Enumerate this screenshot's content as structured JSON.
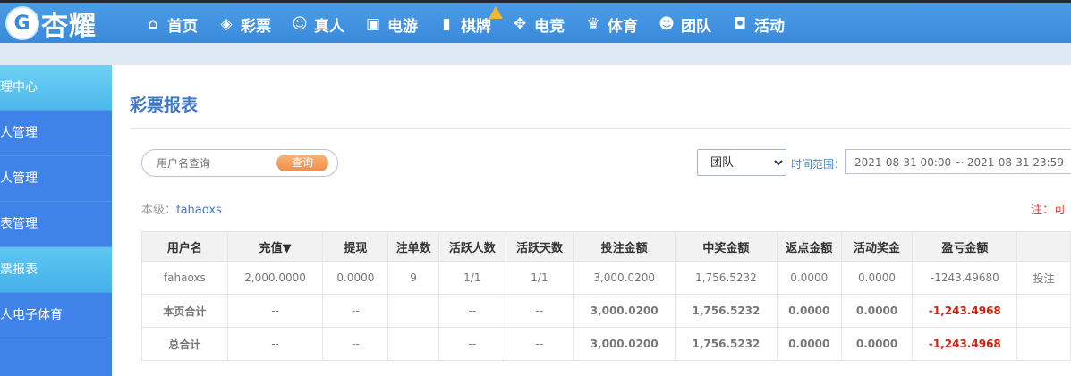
{
  "brand": {
    "name": "杏耀",
    "mark": "G"
  },
  "nav": [
    {
      "label": "首页",
      "icon": "home-icon",
      "glyph": "⌂"
    },
    {
      "label": "彩票",
      "icon": "lottery-icon",
      "glyph": "◈"
    },
    {
      "label": "真人",
      "icon": "user-icon",
      "glyph": "☺"
    },
    {
      "label": "电游",
      "icon": "slot-icon",
      "glyph": "▣"
    },
    {
      "label": "棋牌",
      "icon": "cards-icon",
      "glyph": "▮"
    },
    {
      "label": "电竞",
      "icon": "gamepad-icon",
      "glyph": "✥"
    },
    {
      "label": "体育",
      "icon": "trophy-icon",
      "glyph": "♛"
    },
    {
      "label": "团队",
      "icon": "team-icon",
      "glyph": "☻"
    },
    {
      "label": "活动",
      "icon": "gift-icon",
      "glyph": "◘"
    }
  ],
  "sidebar": {
    "items": [
      {
        "label": "理中心",
        "state": "header"
      },
      {
        "label": "人管理",
        "state": "normal"
      },
      {
        "label": "人管理",
        "state": "normal"
      },
      {
        "label": "表管理",
        "state": "normal"
      },
      {
        "label": "票报表",
        "state": "active"
      },
      {
        "label": "人电子体育",
        "state": "normal"
      }
    ]
  },
  "page": {
    "title": "彩票报表",
    "search": {
      "placeholder": "用户名查询",
      "button": "查询"
    },
    "scope": {
      "selected": "团队"
    },
    "time_label": "时间范围：",
    "time_range": "2021-08-31 00:00 ~ 2021-08-31 23:59",
    "level_label": "本级：",
    "level_user": "fahaoxs",
    "note": "注：可"
  },
  "table": {
    "headers": [
      "用户名",
      "充值▼",
      "提现",
      "注单数",
      "活跃人数",
      "活跃天数",
      "投注金额",
      "中奖金额",
      "返点金额",
      "活动奖金",
      "盈亏金额",
      ""
    ],
    "rows": [
      {
        "cells": [
          "fahaoxs",
          "2,000.0000",
          "0.0000",
          "9",
          "1/1",
          "1/1",
          "3,000.0200",
          "1,756.5232",
          "0.0000",
          "0.0000",
          "-1243.49680",
          "投注"
        ]
      },
      {
        "cells": [
          "本页合计",
          "--",
          "--",
          "",
          "--",
          "--",
          "3,000.0200",
          "1,756.5232",
          "0.0000",
          "0.0000",
          "-1,243.4968",
          ""
        ]
      },
      {
        "cells": [
          "总合计",
          "--",
          "--",
          "",
          "--",
          "--",
          "3,000.0200",
          "1,756.5232",
          "0.0000",
          "0.0000",
          "-1,243.4968",
          ""
        ]
      }
    ]
  },
  "colors": {
    "topbar": "#3a8adb",
    "sidebar": "#3f83e8",
    "accent_text": "#4178c4",
    "negative": "#d63a2a",
    "search_button": "#f08d4a"
  }
}
